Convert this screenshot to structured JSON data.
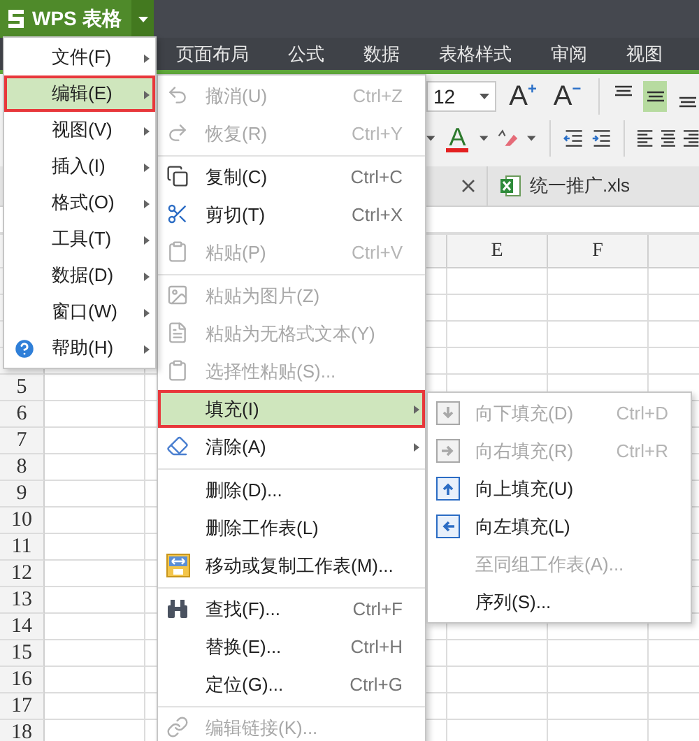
{
  "app_button": {
    "title": "WPS 表格"
  },
  "tabs": [
    {
      "label": "页面布局",
      "selected": false
    },
    {
      "label": "公式",
      "selected": false
    },
    {
      "label": "数据",
      "selected": false
    },
    {
      "label": "表格样式",
      "selected": false
    },
    {
      "label": "审阅",
      "selected": false
    },
    {
      "label": "视图",
      "selected": false
    }
  ],
  "ribbon": {
    "font_size": "12",
    "font_size_buttons": [
      {
        "letter": "A",
        "sign": "+"
      },
      {
        "letter": "A",
        "sign": "−"
      }
    ],
    "font_color_letter": "A",
    "vertical_align": [
      {
        "selected": false
      },
      {
        "selected": true
      },
      {
        "selected": false
      }
    ]
  },
  "document_tab": {
    "filename": "统一推广.xls"
  },
  "sheet": {
    "columns": [
      "E",
      "F"
    ],
    "rows": [
      "5",
      "6",
      "7",
      "8",
      "9",
      "10",
      "11",
      "12",
      "13",
      "14",
      "15",
      "16",
      "17",
      "18"
    ]
  },
  "main_menu": {
    "items": [
      {
        "label": "文件(F)",
        "selected": false
      },
      {
        "label": "编辑(E)",
        "selected": true
      },
      {
        "label": "视图(V)",
        "selected": false
      },
      {
        "label": "插入(I)",
        "selected": false
      },
      {
        "label": "格式(O)",
        "selected": false
      },
      {
        "label": "工具(T)",
        "selected": false
      },
      {
        "label": "数据(D)",
        "selected": false
      },
      {
        "label": "窗口(W)",
        "selected": false
      },
      {
        "label": "帮助(H)",
        "selected": false
      }
    ]
  },
  "edit_menu": {
    "items": [
      {
        "kind": "item",
        "label": "撤消(U)",
        "shortcut": "Ctrl+Z",
        "disabled": true,
        "selected": false,
        "submenu": false
      },
      {
        "kind": "item",
        "label": "恢复(R)",
        "shortcut": "Ctrl+Y",
        "disabled": true,
        "selected": false,
        "submenu": false
      },
      {
        "kind": "separator"
      },
      {
        "kind": "item",
        "label": "复制(C)",
        "shortcut": "Ctrl+C",
        "disabled": false,
        "selected": false,
        "submenu": false
      },
      {
        "kind": "item",
        "label": "剪切(T)",
        "shortcut": "Ctrl+X",
        "disabled": false,
        "selected": false,
        "submenu": false
      },
      {
        "kind": "item",
        "label": "粘贴(P)",
        "shortcut": "Ctrl+V",
        "disabled": true,
        "selected": false,
        "submenu": false
      },
      {
        "kind": "separator"
      },
      {
        "kind": "item",
        "label": "粘贴为图片(Z)",
        "disabled": true,
        "selected": false,
        "submenu": false
      },
      {
        "kind": "item",
        "label": "粘贴为无格式文本(Y)",
        "disabled": true,
        "selected": false,
        "submenu": false
      },
      {
        "kind": "item",
        "label": "选择性粘贴(S)...",
        "disabled": true,
        "selected": false,
        "submenu": false
      },
      {
        "kind": "item",
        "label": "填充(I)",
        "disabled": false,
        "selected": true,
        "submenu": true
      },
      {
        "kind": "item",
        "label": "清除(A)",
        "disabled": false,
        "selected": false,
        "submenu": true
      },
      {
        "kind": "separator"
      },
      {
        "kind": "item",
        "label": "删除(D)...",
        "disabled": false,
        "selected": false,
        "submenu": false
      },
      {
        "kind": "item",
        "label": "删除工作表(L)",
        "disabled": false,
        "selected": false,
        "submenu": false
      },
      {
        "kind": "item",
        "label": "移动或复制工作表(M)...",
        "disabled": false,
        "selected": false,
        "submenu": false
      },
      {
        "kind": "separator"
      },
      {
        "kind": "item",
        "label": "查找(F)...",
        "shortcut": "Ctrl+F",
        "disabled": false,
        "selected": false,
        "submenu": false
      },
      {
        "kind": "item",
        "label": "替换(E)...",
        "shortcut": "Ctrl+H",
        "disabled": false,
        "selected": false,
        "submenu": false
      },
      {
        "kind": "item",
        "label": "定位(G)...",
        "shortcut": "Ctrl+G",
        "disabled": false,
        "selected": false,
        "submenu": false
      },
      {
        "kind": "separator"
      },
      {
        "kind": "item",
        "label": "编辑链接(K)...",
        "disabled": true,
        "selected": false,
        "submenu": false
      }
    ]
  },
  "fill_menu": {
    "items": [
      {
        "label": "向下填充(D)",
        "shortcut": "Ctrl+D",
        "disabled": true,
        "selected": false
      },
      {
        "label": "向右填充(R)",
        "shortcut": "Ctrl+R",
        "disabled": true,
        "selected": false
      },
      {
        "label": "向上填充(U)",
        "disabled": false,
        "selected": false
      },
      {
        "label": "向左填充(L)",
        "disabled": false,
        "selected": false
      },
      {
        "label": "至同组工作表(A)...",
        "disabled": true,
        "selected": false
      },
      {
        "label": "序列(S)...",
        "disabled": false,
        "selected": false
      }
    ]
  }
}
